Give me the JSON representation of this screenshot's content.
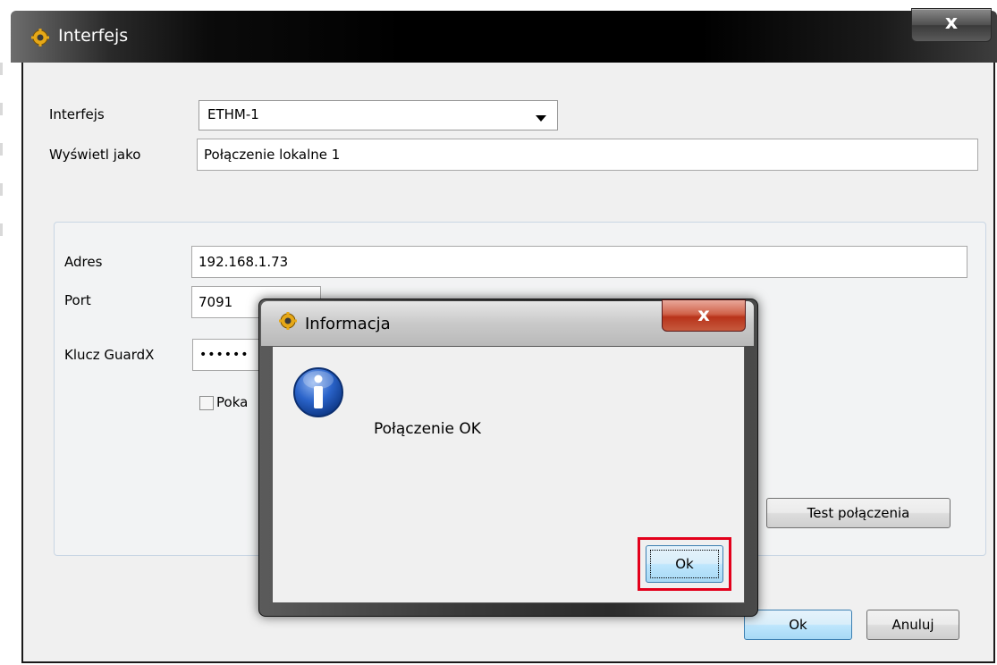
{
  "main_window": {
    "title": "Interfejs",
    "close_label": "x",
    "interface_label": "Interfejs",
    "interface_value": "ETHM-1",
    "display_as_label": "Wyświetl jako",
    "display_as_value": "Połączenie lokalne 1",
    "address_label": "Adres",
    "address_value": "192.168.1.73",
    "port_label": "Port",
    "port_value": "7091",
    "key_label": "Klucz GuardX",
    "key_value": "••••••",
    "show_label": "Poka",
    "test_button": "Test połączenia",
    "ok_button": "Ok",
    "cancel_button": "Anuluj"
  },
  "info_dialog": {
    "title": "Informacja",
    "close_label": "x",
    "message": "Połączenie OK",
    "ok_button": "Ok"
  },
  "colors": {
    "highlight": "#e3001b",
    "info_icon": "#2a63c9"
  }
}
